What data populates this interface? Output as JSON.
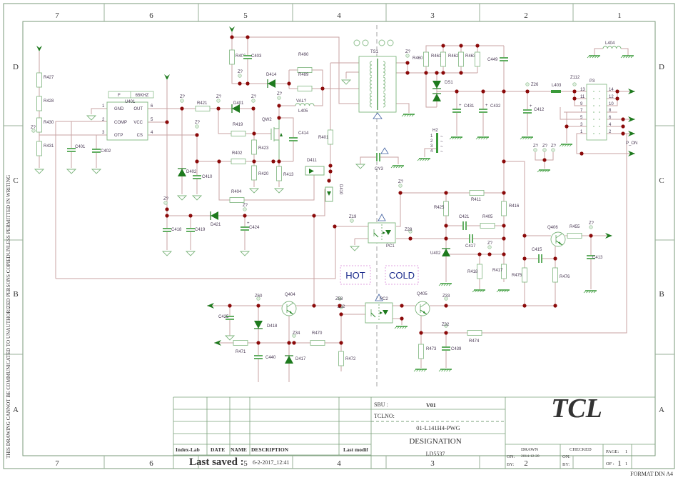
{
  "frame": {
    "columns": [
      "7",
      "6",
      "5",
      "4",
      "3",
      "2",
      "1"
    ],
    "rows": [
      "D",
      "C",
      "B",
      "A"
    ],
    "side_note": "THIS DRAWING CANNOT BE COMMUNICATED TO UNAUTHORIZED PERSONS COPIEDUNLESS  PERMITTED IN WRITING",
    "format": "FORMAT DIN A4"
  },
  "zones": {
    "hot": "HOT",
    "cold": "COLD"
  },
  "ic": {
    "name": "U401",
    "freq_f": "F",
    "freq_value": "65KHZ",
    "pins_left": [
      {
        "num": "1",
        "name": "GND"
      },
      {
        "num": "2",
        "name": "COMP"
      },
      {
        "num": "3",
        "name": "OTP"
      }
    ],
    "pins_right": [
      {
        "num": "6",
        "name": "OUT"
      },
      {
        "num": "5",
        "name": "VCC"
      },
      {
        "num": "4",
        "name": "CS"
      }
    ]
  },
  "connector": {
    "name": "P3",
    "pins_left": [
      "13",
      "11",
      "9",
      "7",
      "5",
      "3",
      "1"
    ],
    "pins_right": [
      "14",
      "12",
      "10",
      "8",
      "6",
      "4",
      "2"
    ],
    "signal": "P_ON"
  },
  "header_h2": {
    "name": "H2",
    "pins": [
      "1",
      "2",
      "3",
      "4"
    ]
  },
  "z_unknown": "Z?",
  "labels": {
    "R427": "R427",
    "R428": "R428",
    "R430": "R430",
    "R431": "R431",
    "C401": "C401",
    "C402": "C402",
    "R421": "R421",
    "D401": "D401",
    "D402": "D402",
    "C410": "C410",
    "R419": "R419",
    "QW2": "QW2",
    "R423": "R423",
    "R402": "R402",
    "R420": "R420",
    "R413": "R413",
    "C414": "C414",
    "L405": "L405",
    "VAL": "VAL?",
    "R404": "R404",
    "D411": "D411",
    "D410": "D410",
    "R401": "R401",
    "C418": "C418",
    "C419": "C419",
    "D421": "D421",
    "C424": "C424",
    "R406": "R406",
    "C403": "C403",
    "R490": "R490",
    "R489": "R489",
    "D414": "D414",
    "TS1": "TS1",
    "R460": "R460",
    "R461": "R461",
    "R462": "R462",
    "R463": "R463",
    "DS1": "DS1",
    "C449": "C449",
    "C431": "C431",
    "C432": "C432",
    "C412": "C412",
    "Z26": "Z26",
    "L403": "L403",
    "Z112": "Z112",
    "L404": "L404",
    "CY3": "CY3",
    "R411": "R411",
    "R425": "R425",
    "R416": "R416",
    "C421": "C421",
    "R405": "R405",
    "PC1": "PC1",
    "Z19": "Z19",
    "Z28": "Z28",
    "C417": "C417",
    "U402": "U402",
    "R418": "R418",
    "R417": "R417",
    "R475": "R475",
    "R476": "R476",
    "Q406": "Q406",
    "R455": "R455",
    "C413": "C413",
    "C415": "C415",
    "Q404": "Q404",
    "Z60": "Z60",
    "C425": "C425",
    "D418": "D418",
    "R471": "R471",
    "C440": "C440",
    "D417": "D417",
    "Z34": "Z34",
    "R470": "R470",
    "Z52": "Z52",
    "R472": "R472",
    "Z58": "Z58",
    "PC2": "PC2",
    "Q405": "Q405",
    "Z33": "Z33",
    "Z32": "Z32",
    "R473": "R473",
    "C439": "C439",
    "R474": "R474"
  },
  "title_block": {
    "sbu_label": "SBU :",
    "sbu_value": "V01",
    "tclno_label": "TCLNO:",
    "tclno_value": "01-L141H4-PWG",
    "designation_label": "DESIGNATION",
    "designation_value": "LD5537",
    "logo": "TCL",
    "col_index_lab": "Index-Lab",
    "col_date": "DATE",
    "col_name": "NAME",
    "col_description": "DESCRIPTION",
    "col_last_modif": "Last modif",
    "last_saved_label": "Last saved :",
    "last_saved_value": "6-2-2017_12:41",
    "drawn_label": "DRAWN",
    "drawn_on_label": "ON:",
    "drawn_on_value": "2014-12-20",
    "drawn_by_label": "BY:",
    "checked_label": "CHECKED",
    "checked_on_label": "ON:",
    "checked_by_label": "BY:",
    "page_label": "PAGE:",
    "page_value": "1",
    "of_label": "OF :",
    "of_value": "1"
  },
  "colors": {
    "wire": "#c9a3a3",
    "component": "#7db57d",
    "component_fill": "#1e7a1e",
    "junction": "#8b0a0a",
    "text": "#4a3a55",
    "logo": "#0d1a5c",
    "hot_cold": "#1a2a8c"
  }
}
